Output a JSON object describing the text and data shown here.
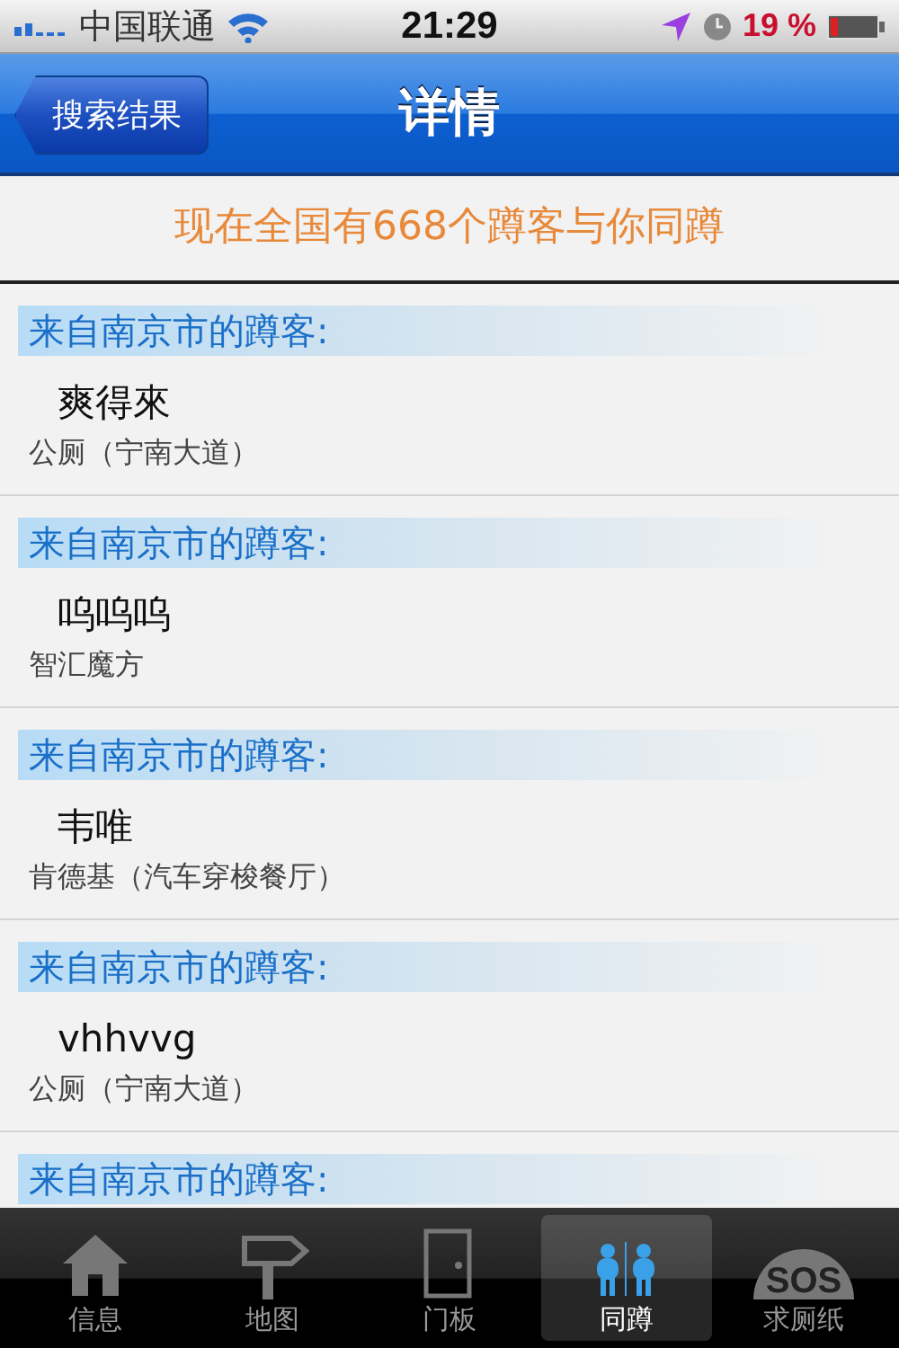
{
  "status_bar": {
    "carrier": "中国联通",
    "time": "21:29",
    "battery": "19 %"
  },
  "nav_bar": {
    "back_button": "搜索结果",
    "title": "详情"
  },
  "banner": "现在全国有668个蹲客与你同蹲",
  "visitors": [
    {
      "header": "来自南京市的蹲客:",
      "name": "爽得來",
      "place": "公厕（宁南大道）"
    },
    {
      "header": "来自南京市的蹲客:",
      "name": "呜呜呜",
      "place": "智汇魔方"
    },
    {
      "header": "来自南京市的蹲客:",
      "name": "韦唯",
      "place": "肯德基（汽车穿梭餐厅）"
    },
    {
      "header": "来自南京市的蹲客:",
      "name": "vhhvvg",
      "place": "公厕（宁南大道）"
    },
    {
      "header": "来自南京市的蹲客:"
    }
  ],
  "tab_bar": [
    {
      "kind": "house",
      "label": "信息",
      "selected": false
    },
    {
      "kind": "signpost",
      "label": "地图",
      "selected": false
    },
    {
      "kind": "door",
      "label": "门板",
      "selected": false
    },
    {
      "kind": "people",
      "label": "同蹲",
      "selected": true
    },
    {
      "kind": "sos",
      "label": "求厕纸",
      "selected": false,
      "icon_text": "SOS"
    }
  ]
}
